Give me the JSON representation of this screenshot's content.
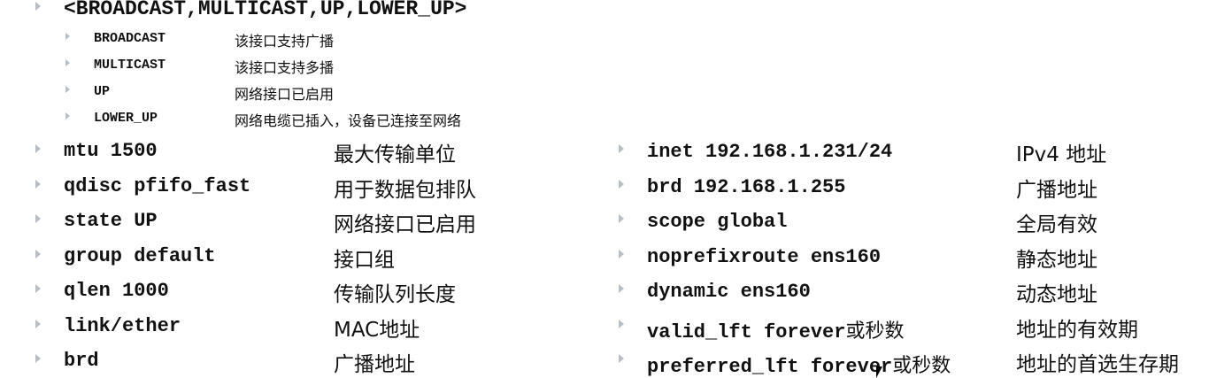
{
  "heading": "<BROADCAST,MULTICAST,UP,LOWER_UP>",
  "flags": [
    {
      "key": "BROADCAST",
      "desc": "该接口支持广播"
    },
    {
      "key": "MULTICAST",
      "desc": "该接口支持多播"
    },
    {
      "key": "UP",
      "desc": "网络接口已启用"
    },
    {
      "key": "LOWER_UP",
      "desc": "网络电缆已插入，设备已连接至网络"
    }
  ],
  "left": [
    {
      "key": "mtu 1500",
      "desc": "最大传输单位"
    },
    {
      "key": "qdisc pfifo_fast",
      "desc": "用于数据包排队"
    },
    {
      "key": "state UP",
      "desc": "网络接口已启用"
    },
    {
      "key": "group default",
      "desc": "接口组"
    },
    {
      "key": "qlen 1000",
      "desc": "传输队列长度"
    },
    {
      "key": "link/ether",
      "desc": "MAC地址"
    },
    {
      "key": "brd",
      "desc": "广播地址"
    }
  ],
  "right": [
    {
      "key": "inet 192.168.1.231/24",
      "suffix": "",
      "desc": "IPv4 地址"
    },
    {
      "key": "brd 192.168.1.255",
      "suffix": "",
      "desc": "广播地址"
    },
    {
      "key": "scope global",
      "suffix": "",
      "desc": "全局有效"
    },
    {
      "key": "noprefixroute ens160",
      "suffix": "",
      "desc": "静态地址"
    },
    {
      "key": "dynamic ens160",
      "suffix": "",
      "desc": "动态地址"
    },
    {
      "key": "valid_lft forever",
      "suffix": "或秒数",
      "desc": "地址的有效期"
    },
    {
      "key": "preferred_lft forever",
      "suffix": "或秒数",
      "desc": "地址的首选生存期"
    }
  ]
}
